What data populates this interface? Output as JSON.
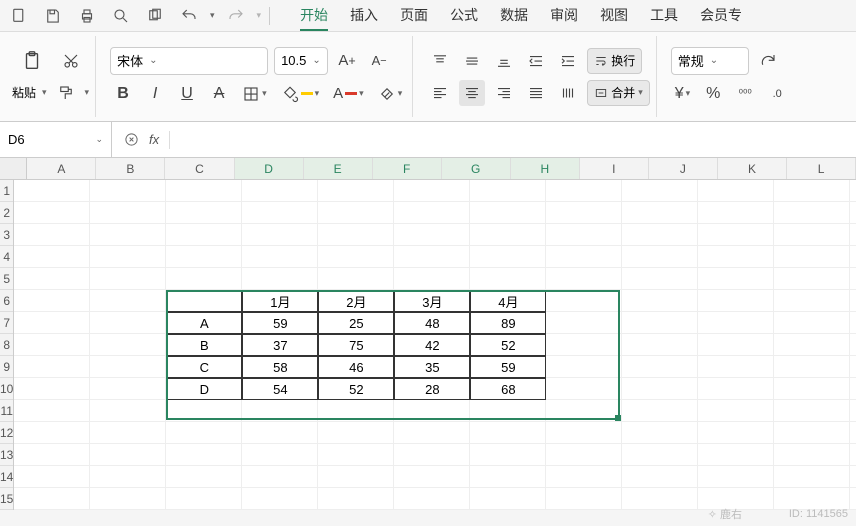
{
  "qat": {
    "undo": "↶",
    "redo": "↷"
  },
  "menu": {
    "tabs": [
      "开始",
      "插入",
      "页面",
      "公式",
      "数据",
      "审阅",
      "视图",
      "工具",
      "会员专"
    ],
    "active": 0
  },
  "clipboard": {
    "paste": "粘贴"
  },
  "font": {
    "name": "宋体",
    "size": "10.5",
    "bold": "B",
    "italic": "I",
    "underline": "U",
    "strike": "A"
  },
  "align": {
    "wrap": "换行",
    "merge": "合并"
  },
  "number": {
    "format": "常规"
  },
  "nameBox": "D6",
  "fx": "fx",
  "columns": [
    "A",
    "B",
    "C",
    "D",
    "E",
    "F",
    "G",
    "H",
    "I",
    "J",
    "K",
    "L"
  ],
  "selectedCols": [
    "D",
    "E",
    "F",
    "G",
    "H"
  ],
  "rowCount": 15,
  "table": {
    "startCol": 2,
    "startRow": 5,
    "headers": [
      "",
      "1月",
      "2月",
      "3月",
      "4月"
    ],
    "rows": [
      [
        "A",
        "59",
        "25",
        "48",
        "89"
      ],
      [
        "B",
        "37",
        "75",
        "42",
        "52"
      ],
      [
        "C",
        "58",
        "46",
        "35",
        "59"
      ],
      [
        "D",
        "54",
        "52",
        "28",
        "68"
      ]
    ]
  },
  "selection": {
    "col0": 2,
    "row0": 5,
    "col1": 7,
    "row1": 10
  },
  "watermark": "ID: 1141565",
  "logo": "鹿右"
}
